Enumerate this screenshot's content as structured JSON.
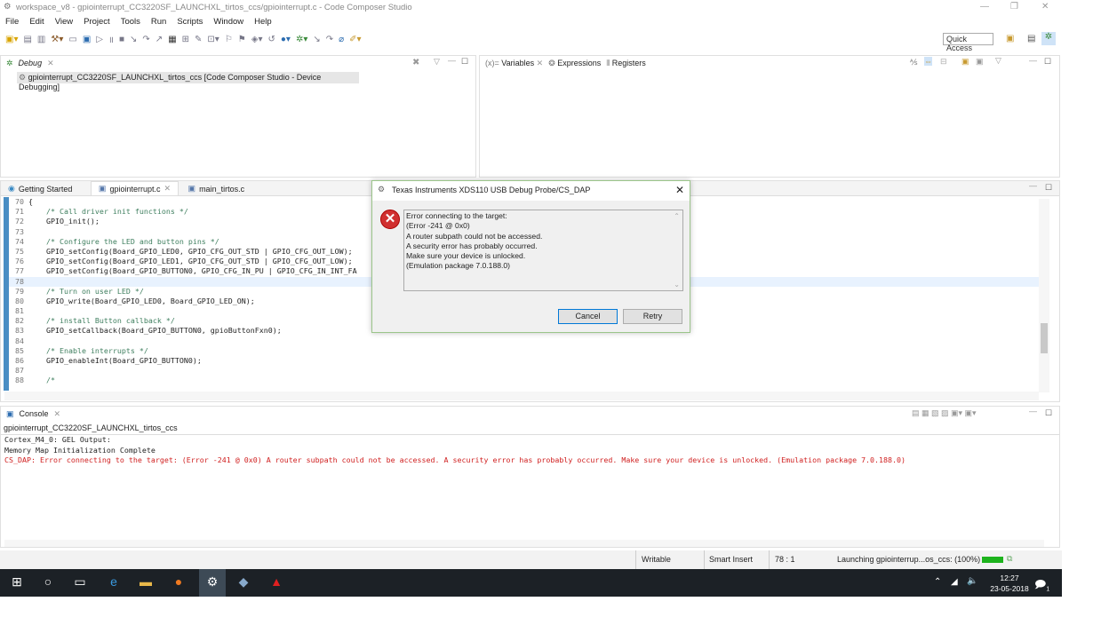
{
  "window": {
    "title": "workspace_v8 - gpiointerrupt_CC3220SF_LAUNCHXL_tirtos_ccs/gpiointerrupt.c - Code Composer Studio"
  },
  "menu": [
    "File",
    "Edit",
    "View",
    "Project",
    "Tools",
    "Run",
    "Scripts",
    "Window",
    "Help"
  ],
  "toolbar": {
    "quick_access": "Quick Access"
  },
  "debug": {
    "tab": "Debug",
    "item": "gpiointerrupt_CC3220SF_LAUNCHXL_tirtos_ccs [Code Composer Studio - Device Debugging]"
  },
  "vars": {
    "tabs": [
      "Variables",
      "Expressions",
      "Registers"
    ]
  },
  "editor": {
    "tabs": [
      "Getting Started",
      "gpiointerrupt.c",
      "main_tirtos.c"
    ],
    "lines": [
      {
        "n": "70",
        "t": "{",
        "c": false
      },
      {
        "n": "71",
        "t": "    /* Call driver init functions */",
        "c": true
      },
      {
        "n": "72",
        "t": "    GPIO_init();",
        "c": false
      },
      {
        "n": "73",
        "t": "",
        "c": false
      },
      {
        "n": "74",
        "t": "    /* Configure the LED and button pins */",
        "c": true
      },
      {
        "n": "75",
        "t": "    GPIO_setConfig(Board_GPIO_LED0, GPIO_CFG_OUT_STD | GPIO_CFG_OUT_LOW);",
        "c": false
      },
      {
        "n": "76",
        "t": "    GPIO_setConfig(Board_GPIO_LED1, GPIO_CFG_OUT_STD | GPIO_CFG_OUT_LOW);",
        "c": false
      },
      {
        "n": "77",
        "t": "    GPIO_setConfig(Board_GPIO_BUTTON0, GPIO_CFG_IN_PU | GPIO_CFG_IN_INT_FA",
        "c": false
      },
      {
        "n": "78",
        "t": "",
        "c": false
      },
      {
        "n": "79",
        "t": "    /* Turn on user LED */",
        "c": true
      },
      {
        "n": "80",
        "t": "    GPIO_write(Board_GPIO_LED0, Board_GPIO_LED_ON);",
        "c": false
      },
      {
        "n": "81",
        "t": "",
        "c": false
      },
      {
        "n": "82",
        "t": "    /* install Button callback */",
        "c": true
      },
      {
        "n": "83",
        "t": "    GPIO_setCallback(Board_GPIO_BUTTON0, gpioButtonFxn0);",
        "c": false
      },
      {
        "n": "84",
        "t": "",
        "c": false
      },
      {
        "n": "85",
        "t": "    /* Enable interrupts */",
        "c": true
      },
      {
        "n": "86",
        "t": "    GPIO_enableInt(Board_GPIO_BUTTON0);",
        "c": false
      },
      {
        "n": "87",
        "t": "",
        "c": false
      },
      {
        "n": "88",
        "t": "    /*",
        "c": true
      }
    ]
  },
  "console": {
    "tab": "Console",
    "name": "gpiointerrupt_CC3220SF_LAUNCHXL_tirtos_ccs",
    "lines": [
      "Cortex_M4_0: GEL Output:",
      "Memory Map Initialization Complete"
    ],
    "error": "CS_DAP: Error connecting to the target: (Error -241 @ 0x0) A router subpath could not be accessed. A security error has probably occurred. Make sure your device is unlocked. (Emulation package 7.0.188.0)"
  },
  "status": {
    "writable": "Writable",
    "insert": "Smart Insert",
    "position": "78 : 1",
    "progress_text": "Launching gpiointerrup...os_ccs: (100%)",
    "progress": 100
  },
  "dialog": {
    "title": "Texas Instruments XDS110 USB Debug Probe/CS_DAP",
    "message": [
      "Error connecting to the target:",
      "(Error -241 @ 0x0)",
      "A router subpath could not be accessed.",
      "A security error has probably occurred.",
      "Make sure your device is unlocked.",
      "(Emulation package 7.0.188.0)"
    ],
    "cancel": "Cancel",
    "retry": "Retry"
  },
  "taskbar": {
    "time": "12:27",
    "date": "23-05-2018",
    "notifications": "1"
  },
  "colors": {
    "error": "#c0392b",
    "accent": "#4a8ec4",
    "progress": "#1db31d"
  }
}
